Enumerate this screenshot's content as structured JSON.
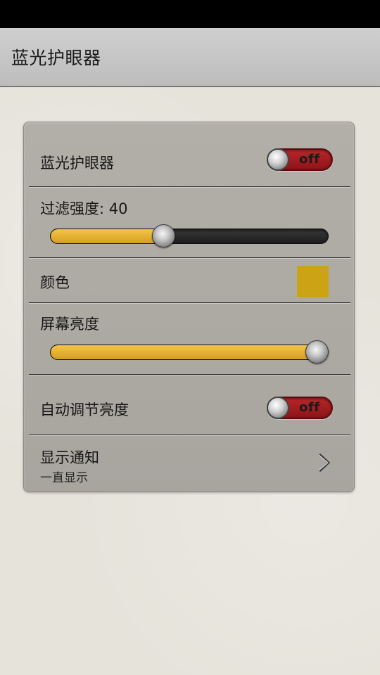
{
  "app": {
    "title": "蓝光护眼器"
  },
  "settings": {
    "bluelight": {
      "label": "蓝光护眼器",
      "toggle": "off",
      "on": false
    },
    "filter": {
      "label": "过滤强度: 40",
      "value": 40,
      "max": 100
    },
    "color": {
      "label": "颜色",
      "swatch": "#cca314"
    },
    "brightness": {
      "label": "屏幕亮度",
      "value": 100,
      "max": 100
    },
    "auto_brightness": {
      "label": "自动调节亮度",
      "toggle": "off",
      "on": false
    },
    "notification": {
      "label": "显示通知",
      "sublabel": "一直显示",
      "icon": "chevron-right-icon"
    }
  },
  "colors": {
    "slider_fill": "#e5b333",
    "toggle_off": "#a11c20",
    "swatch": "#cca314"
  }
}
